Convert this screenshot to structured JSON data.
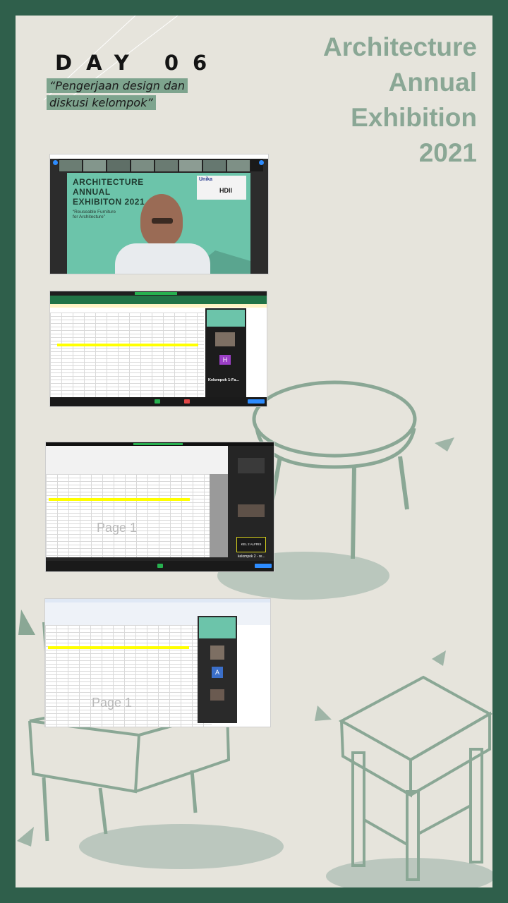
{
  "day_label": "DAY 06",
  "subtitle_line1": "“Pengerjaan design dan",
  "subtitle_line2": "diskusi kelompok”",
  "title_lines": [
    "Architecture",
    "Annual",
    "Exhibition",
    "2021"
  ],
  "colors": {
    "frame": "#2f5f4b",
    "background": "#e6e4dc",
    "accent": "#7ea48e",
    "title": "#8aa795"
  },
  "screenshot_1": {
    "slide_title_lines": [
      "ARCHITECTURE",
      "ANNUAL",
      "EXHIBITON 2021"
    ],
    "slide_subtitle_lines": [
      "“Reuseable Furniture",
      "for Architecture”"
    ],
    "logo_text": "Unika",
    "logo_text_2": "HDII"
  },
  "screenshot_2": {
    "participant_letter": "H",
    "group_label": "Kelompok 1-Fa..."
  },
  "screenshot_3": {
    "watermark": "Page 1",
    "participant_label": "KEL 2 ALFRIS",
    "group_label": "kelompok 2 - re..."
  },
  "screenshot_4": {
    "watermark": "Page 1",
    "participant_letter": "A"
  }
}
